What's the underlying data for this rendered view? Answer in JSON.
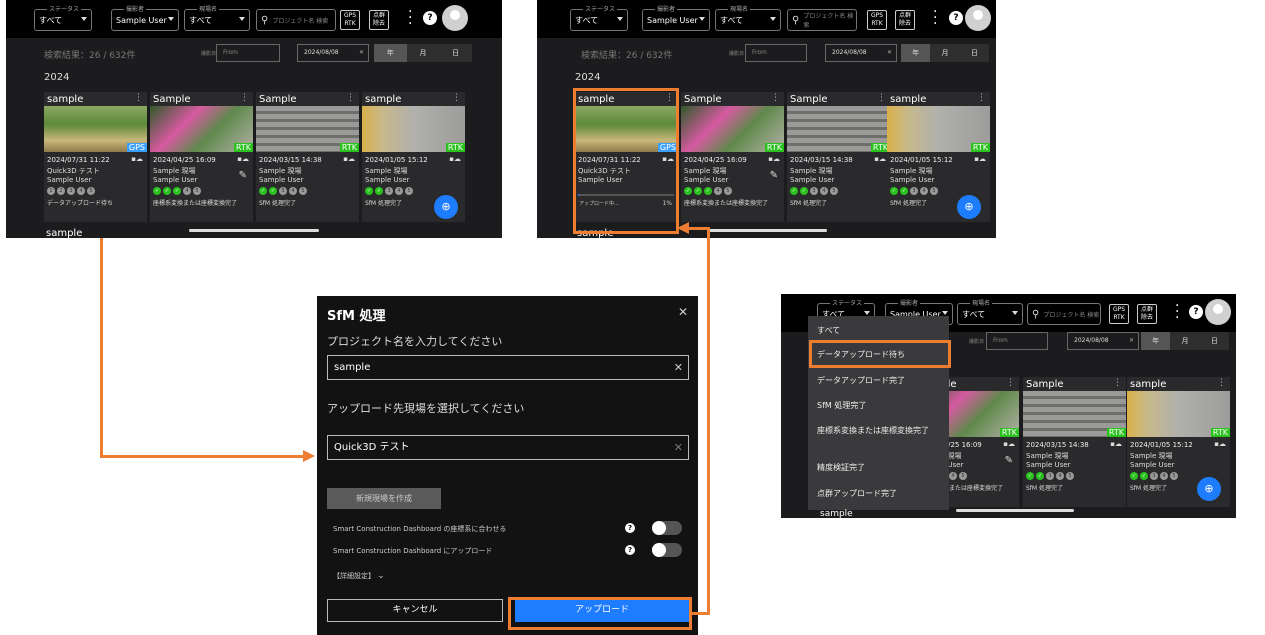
{
  "topbar": {
    "status_legend": "ステータス",
    "status_value": "すべて",
    "photographer_legend": "撮影者",
    "photographer_value": "Sample User",
    "site_legend": "現場名",
    "site_value": "すべて",
    "search_placeholder": "プロジェクト名 検索",
    "gps_rtk_label": "GPS RTK",
    "points_label": "点群 除去"
  },
  "searchbar": {
    "result_count": "検索結果：26 / 632件",
    "date_label": "撮影日",
    "from_placeholder": "From",
    "to_value": "2024/08/08",
    "seg_year": "年",
    "seg_month": "月",
    "seg_day": "日"
  },
  "year_heading": "2024",
  "cards": [
    {
      "title": "sample",
      "date": "2024/07/31 11:22",
      "line1": "Quick3D テスト",
      "line2": "Sample User",
      "badge": "GPS",
      "status": "データアップロード待ち",
      "checks": 0
    },
    {
      "title": "Sample",
      "date": "2024/04/25 16:09",
      "line1": "Sample 現場",
      "line2": "Sample User",
      "badge": "RTK",
      "status": "座標系変換または座標変換完了",
      "checks": 3
    },
    {
      "title": "Sample",
      "date": "2024/03/15 14:38",
      "line1": "Sample 現場",
      "line2": "Sample User",
      "badge": "RTK",
      "status": "SfM 処理完了",
      "checks": 2
    },
    {
      "title": "sample",
      "date": "2024/01/05 15:12",
      "line1": "Sample 現場",
      "line2": "Sample User",
      "badge": "RTK",
      "status": "SfM 処理完了",
      "checks": 2
    }
  ],
  "next_card_title": "sample",
  "step_numbers": [
    "1",
    "2",
    "3",
    "4",
    "5"
  ],
  "uploading": {
    "label": "アップロード中…",
    "percent": "1%",
    "progress": 0.01
  },
  "dialog": {
    "title": "SfM 処理",
    "project_prompt": "プロジェクト名を入力してください",
    "project_value": "sample",
    "site_prompt": "アップロード先現場を選択してください",
    "site_value": "Quick3D テスト",
    "new_site_button": "新規現場を作成",
    "option1": "Smart Construction Dashboard の座標系に合わせる",
    "option2": "Smart Construction Dashboard にアップロード",
    "advanced": "【詳細設定】",
    "cancel_button": "キャンセル",
    "upload_button": "アップロード"
  },
  "status_menu": {
    "items": [
      "すべて",
      "データアップロード待ち",
      "データアップロード完了",
      "SfM 処理完了",
      "座標系変換または座標変換完了",
      "精度検証完了",
      "点群アップロード完了"
    ]
  },
  "colors": {
    "highlight": "#ed7d31",
    "accent": "#1e7cff",
    "rtk": "#2bc21f",
    "gps": "#3aa0ff"
  }
}
